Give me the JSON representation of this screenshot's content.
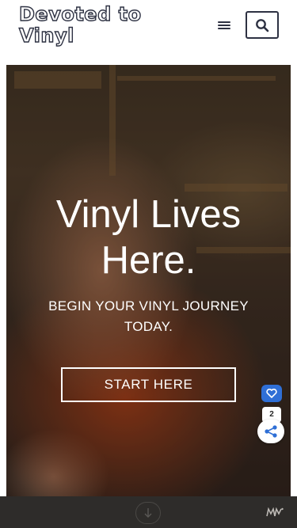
{
  "header": {
    "logo_line1": "Devoted to",
    "logo_line2": "Vinyl",
    "menu_icon": "hamburger-icon",
    "search_icon": "search-icon"
  },
  "hero": {
    "title_line1": "Vinyl Lives",
    "title_line2": "Here.",
    "subtitle": "BEGIN YOUR VINYL JOURNEY TODAY.",
    "cta_label": "START HERE"
  },
  "share_widget": {
    "like_icon": "heart-icon",
    "count": "2",
    "share_icon": "share-icon",
    "like_color": "#2f6fd6"
  },
  "bottom_bar": {
    "scroll_icon": "arrow-down-icon",
    "brand_icon": "brand-mark-icon",
    "background": "#2e2c2a"
  },
  "colors": {
    "accent": "#2d3142",
    "text_on_hero": "#ffffff"
  }
}
